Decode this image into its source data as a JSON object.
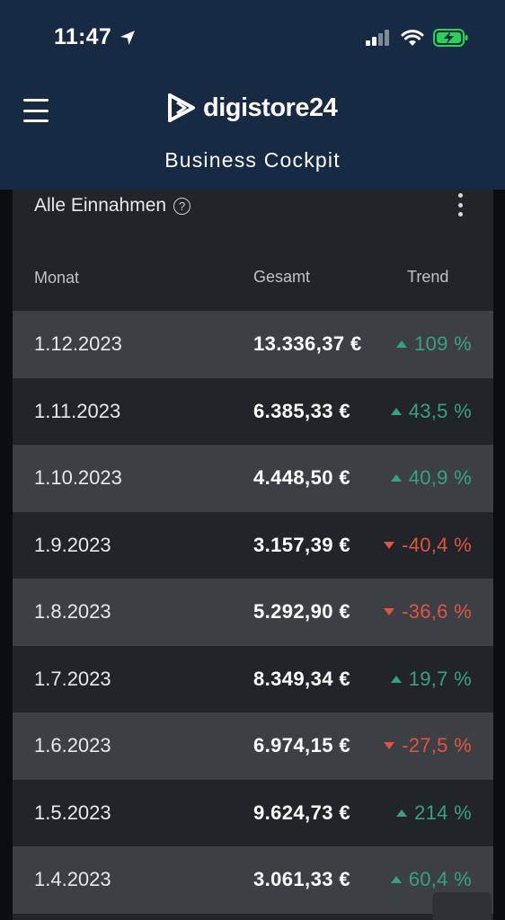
{
  "status_bar": {
    "time": "11:47"
  },
  "header": {
    "logo_text": "digistore24",
    "subtitle": "Business Cockpit"
  },
  "card": {
    "title": "Alle Einnahmen",
    "help_glyph": "?",
    "columns": {
      "month": "Monat",
      "total": "Gesamt",
      "trend": "Trend"
    },
    "rows": [
      {
        "month": "1.12.2023",
        "total": "13.336,37 €",
        "trend": "109 %",
        "direction": "up"
      },
      {
        "month": "1.11.2023",
        "total": "6.385,33 €",
        "trend": "43,5 %",
        "direction": "up"
      },
      {
        "month": "1.10.2023",
        "total": "4.448,50 €",
        "trend": "40,9 %",
        "direction": "up"
      },
      {
        "month": "1.9.2023",
        "total": "3.157,39 €",
        "trend": "-40,4 %",
        "direction": "down"
      },
      {
        "month": "1.8.2023",
        "total": "5.292,90 €",
        "trend": "-36,6 %",
        "direction": "down"
      },
      {
        "month": "1.7.2023",
        "total": "8.349,34 €",
        "trend": "19,7 %",
        "direction": "up"
      },
      {
        "month": "1.6.2023",
        "total": "6.974,15 €",
        "trend": "-27,5 %",
        "direction": "down"
      },
      {
        "month": "1.5.2023",
        "total": "9.624,73 €",
        "trend": "214 %",
        "direction": "up"
      },
      {
        "month": "1.4.2023",
        "total": "3.061,33 €",
        "trend": "60,4 %",
        "direction": "up"
      }
    ]
  },
  "colors": {
    "header_bg": "#172a43",
    "card_bg": "#212529",
    "row_alt_bg": "#3c4044",
    "trend_up": "#3aa17f",
    "trend_down": "#e0553f",
    "battery_green": "#2ed158"
  },
  "icons": {
    "menu": "hamburger-menu-icon",
    "location": "location-arrow-icon",
    "signal": "cellular-signal-icon",
    "wifi": "wifi-icon",
    "battery": "battery-charging-icon",
    "help": "help-circle-icon",
    "more": "more-vertical-icon",
    "logo": "digistore-logo-icon"
  }
}
